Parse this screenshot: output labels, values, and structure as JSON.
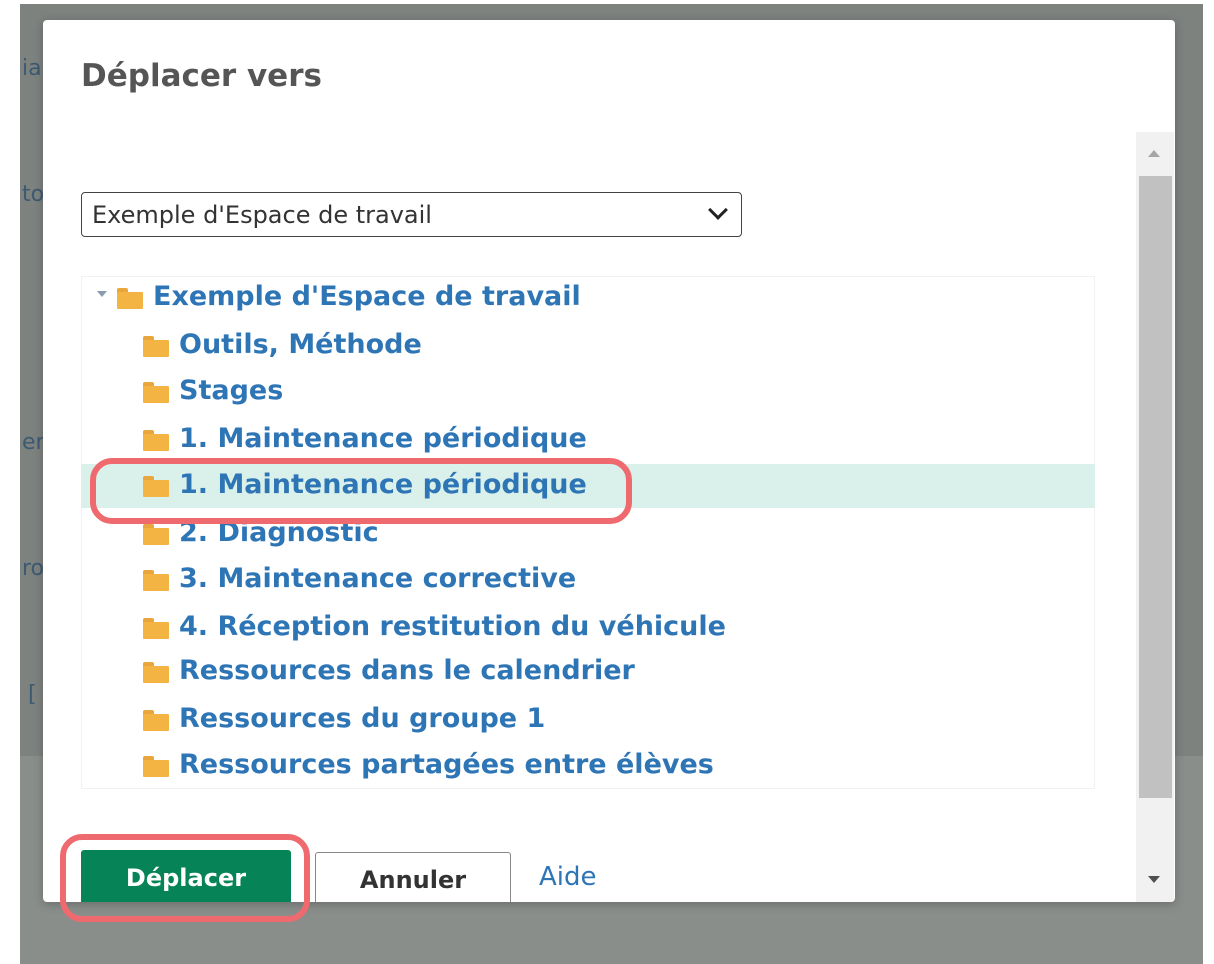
{
  "background_fragments": [
    "ia",
    "to",
    "er",
    "ro",
    "["
  ],
  "modal": {
    "title": "Déplacer vers"
  },
  "workspace_select": {
    "value": "Exemple d'Espace de travail"
  },
  "tree": {
    "root": "Exemple d'Espace de travail",
    "items": [
      "Outils, Méthode",
      "Stages",
      "1. Maintenance périodique",
      "1. Maintenance périodique",
      "2. Diagnostic",
      "3. Maintenance corrective",
      "4. Réception restitution du véhicule",
      "Ressources dans le calendrier",
      "Ressources du groupe 1",
      "Ressources partagées entre élèves"
    ],
    "selected_index": 3
  },
  "footer": {
    "move_label": "Déplacer",
    "cancel_label": "Annuler",
    "help_label": "Aide"
  },
  "colors": {
    "primary_button": "#068457",
    "link": "#2e75b6",
    "selected_row": "#daf0ea",
    "folder": "#f3b443",
    "annotation": "#ef6a6e"
  }
}
